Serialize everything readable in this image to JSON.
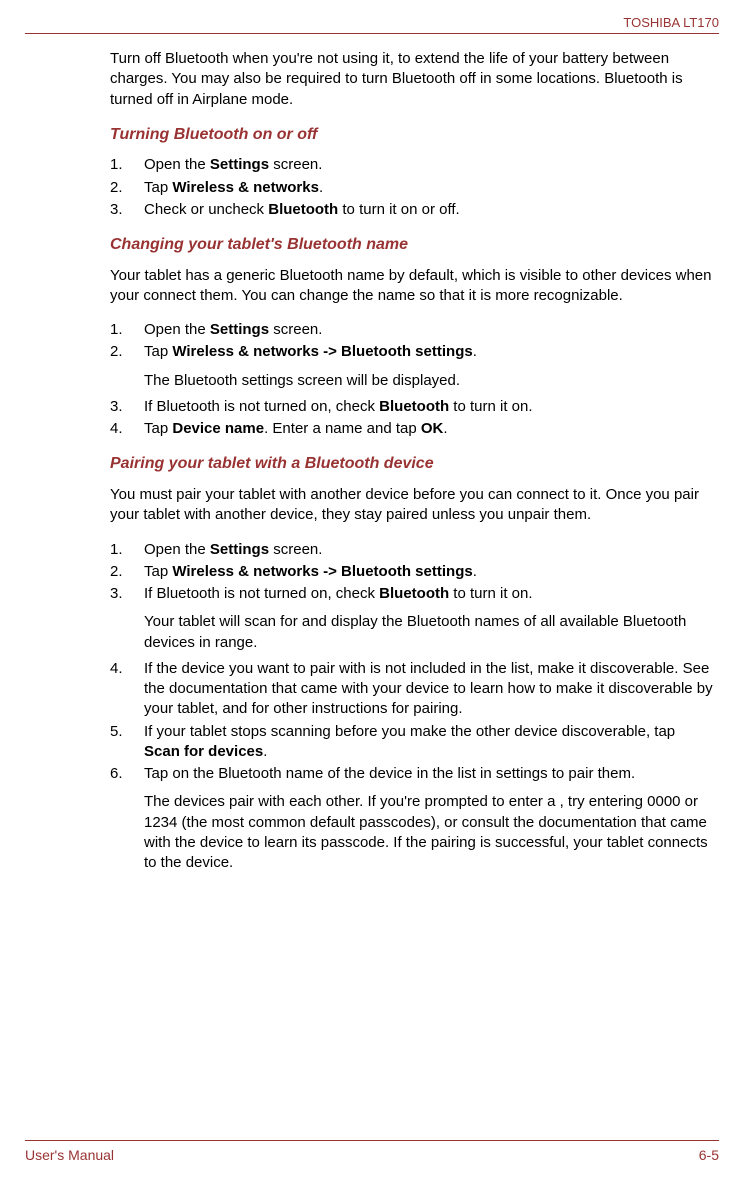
{
  "header": {
    "product": "TOSHIBA LT170"
  },
  "intro": "Turn off Bluetooth when you're not using it, to extend the life of your battery between charges. You may also be required to turn Bluetooth off in some locations. Bluetooth is turned off in Airplane mode.",
  "section1": {
    "title": "Turning Bluetooth on or off",
    "items": [
      {
        "pre": "Open the ",
        "bold": "Settings",
        "post": " screen."
      },
      {
        "pre": "Tap ",
        "bold": "Wireless & networks",
        "post": "."
      },
      {
        "pre": "Check or uncheck ",
        "bold": "Bluetooth",
        "post": " to turn it on or off."
      }
    ]
  },
  "section2": {
    "title": "Changing your tablet's Bluetooth name",
    "intro": "Your tablet has a generic Bluetooth name by default, which is visible to other devices when your connect them. You can change the name so that it is more recognizable.",
    "item1": {
      "pre": "Open the ",
      "bold": "Settings",
      "post": " screen."
    },
    "item2": {
      "pre": "Tap ",
      "bold": "Wireless & networks -> Bluetooth settings",
      "post": ".",
      "extra": "The Bluetooth settings screen will be displayed."
    },
    "item3": {
      "pre": "If Bluetooth is not turned on, check ",
      "bold": "Bluetooth",
      "post": " to turn it on."
    },
    "item4": {
      "pre": "Tap ",
      "bold1": "Device name",
      "mid": ". Enter a name and tap ",
      "bold2": "OK",
      "post": "."
    }
  },
  "section3": {
    "title": "Pairing your tablet with a Bluetooth device",
    "intro": "You must pair your tablet with another device before you can connect to it. Once you pair your tablet with another device, they stay paired unless you unpair them.",
    "item1": {
      "pre": "Open the ",
      "bold": "Settings",
      "post": " screen."
    },
    "item2": {
      "pre": "Tap ",
      "bold": "Wireless & networks -> Bluetooth settings",
      "post": "."
    },
    "item3": {
      "pre": "If Bluetooth is not turned on, check ",
      "bold": "Bluetooth",
      "post": " to turn it on.",
      "extra": "Your tablet will scan for and display the Bluetooth names of all available Bluetooth devices in range."
    },
    "item4": {
      "text": "If the device you want to pair with is not included in the list, make it discoverable. See the documentation that came with your device to learn how to make it discoverable by your tablet, and for other instructions for pairing."
    },
    "item5": {
      "pre": "If your tablet stops scanning before you make the other device discoverable, tap ",
      "bold": "Scan for devices",
      "post": "."
    },
    "item6": {
      "text": "Tap on the Bluetooth name of the device in the list in settings to pair them.",
      "extra": "The devices pair with each other. If you're prompted to enter a , try entering 0000 or 1234 (the most common default passcodes), or consult the documentation that came with the device to learn its passcode. If the pairing is successful, your tablet connects to the device."
    }
  },
  "footer": {
    "left": "User's Manual",
    "right": "6-5"
  }
}
